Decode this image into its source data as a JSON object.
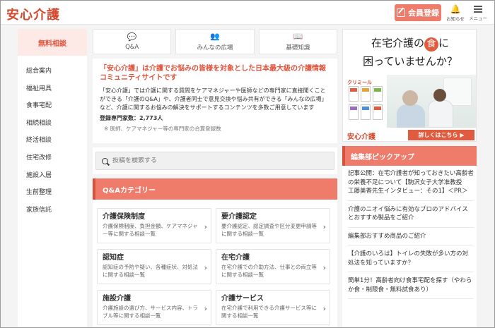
{
  "header": {
    "logo": "安心介護",
    "register_label": "会員登録",
    "notifications_label": "お知らせ",
    "menu_label": "メニュー",
    "icons": {
      "register": "pen-icon",
      "notifications": "bell-icon",
      "menu": "hamburger-icon"
    }
  },
  "sidebar": {
    "head": "無料相談",
    "items": [
      "総合案内",
      "福祉用具",
      "食事宅配",
      "相続相談",
      "終活相談",
      "住宅改修",
      "施設入居",
      "生前整理",
      "家族信託"
    ]
  },
  "tabs": [
    {
      "label": "Q&A",
      "icon": "chat-bubbles-icon"
    },
    {
      "label": "みんなの広場",
      "icon": "people-icon"
    },
    {
      "label": "基礎知識",
      "icon": "book-icon"
    }
  ],
  "intro": {
    "title": "「安心介護」は介護でお悩みの皆様を対象とした日本最大級の介護情報コミュニティサイトです",
    "body": "「安心介護」では介護に関する質問をケアマネジャーや医師などの専門家に直接聞くことができる「介護のQ&A」や、介護者同士で意見交換や悩み共有ができる「みんなの広場」など、介護に関するお悩みの解決をサポートするコンテンツを多数ご用意しています",
    "count": "登録専門家数：2,773人",
    "note": "※ 医師、ケアマネジャー等の専門家の合算登録数"
  },
  "search": {
    "placeholder": "投稿を検索する"
  },
  "qa_categories": {
    "title": "Q&Aカテゴリー",
    "items": [
      {
        "name": "介護保険制度",
        "desc": "介護保険制度、負担金額、ケアマネジャー等に関する相談一覧"
      },
      {
        "name": "要介護認定",
        "desc": "要介護認定、認定調査や区分変更申請等に関する相談一覧"
      },
      {
        "name": "認知症",
        "desc": "認知症の予防や疑い、各種症状、対処法に関する相談一覧"
      },
      {
        "name": "在宅介護",
        "desc": "在宅介護での介助方法、仕事との両立等に関する相談一覧"
      },
      {
        "name": "施設介護",
        "desc": "介護施設の選び方、サービス内容、トラブル等に関する相談一覧"
      },
      {
        "name": "介護サービス",
        "desc": "在宅介護で利用できる介護サービス等に関する相談一覧"
      }
    ]
  },
  "ad": {
    "line1_pre": "在宅介護の",
    "line1_mark": "食",
    "line1_post": "に",
    "line2": "困っていませんか？",
    "brand": "クリミール",
    "logo": "安心介護",
    "cta": "詳しくはこちら ▶"
  },
  "editor_picks": {
    "title": "編集部ピックアップ",
    "items": [
      "記事公開：在宅介護者が知っておきたい高齢者の栄養不足について【駒沢女子大学准教授　工藤美香先生インタビュー：その1】＜PR＞",
      "介護のニオイ悩みに有効なプロのアドバイスとおすすめ製品をご紹介",
      "編集部おすすめ商品のご紹介",
      "【介護のいろは】トイレの失敗が多い方の対処法を知っていますか？",
      "簡単1分！高齢者向け食事宅配を探す（やわらか食・制限食・無料試食あり）"
    ]
  }
}
